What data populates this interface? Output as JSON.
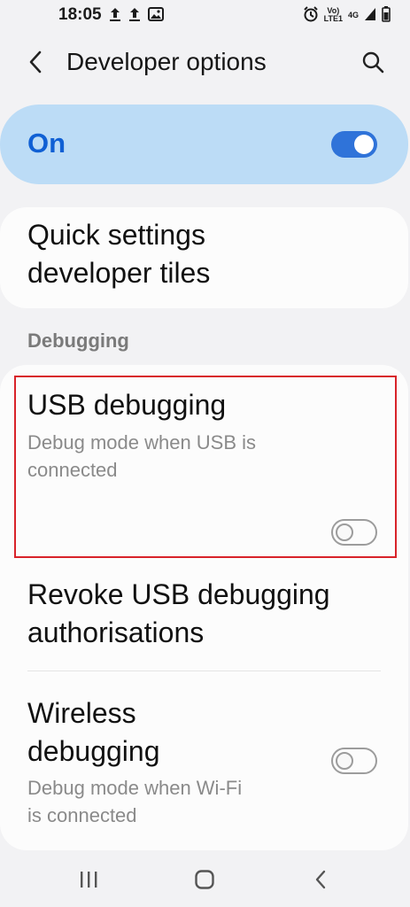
{
  "status_bar": {
    "time": "18:05",
    "network_label_top": "Vo)",
    "network_label_bottom": "LTE1",
    "signal_type": "4G",
    "icons": [
      "upload-icon",
      "upload-icon",
      "image-icon",
      "alarm-icon",
      "signal-icon",
      "battery-icon"
    ]
  },
  "app_bar": {
    "title": "Developer options",
    "back_icon": "chevron-left-icon",
    "search_icon": "search-icon"
  },
  "master_switch": {
    "label": "On",
    "state": "on"
  },
  "items": {
    "quick_settings": {
      "title_line1": "Quick settings",
      "title_line2": "developer tiles"
    },
    "section_debugging": "Debugging",
    "usb_debugging": {
      "title": "USB debugging",
      "subtitle_line1": "Debug mode when USB is",
      "subtitle_line2": "connected",
      "state": "off"
    },
    "revoke_usb": {
      "title_line1": "Revoke USB debugging",
      "title_line2": "authorisations"
    },
    "wireless_debugging": {
      "title_line1": "Wireless",
      "title_line2": "debugging",
      "subtitle_line1": "Debug mode when Wi-Fi",
      "subtitle_line2": "is connected",
      "state": "off"
    }
  },
  "colors": {
    "accent": "#1060d4",
    "master_bg": "#bcdcf6",
    "highlight_border": "#d8232a"
  },
  "nav_bar": {
    "buttons": [
      "recents-icon",
      "home-icon",
      "back-icon"
    ]
  }
}
